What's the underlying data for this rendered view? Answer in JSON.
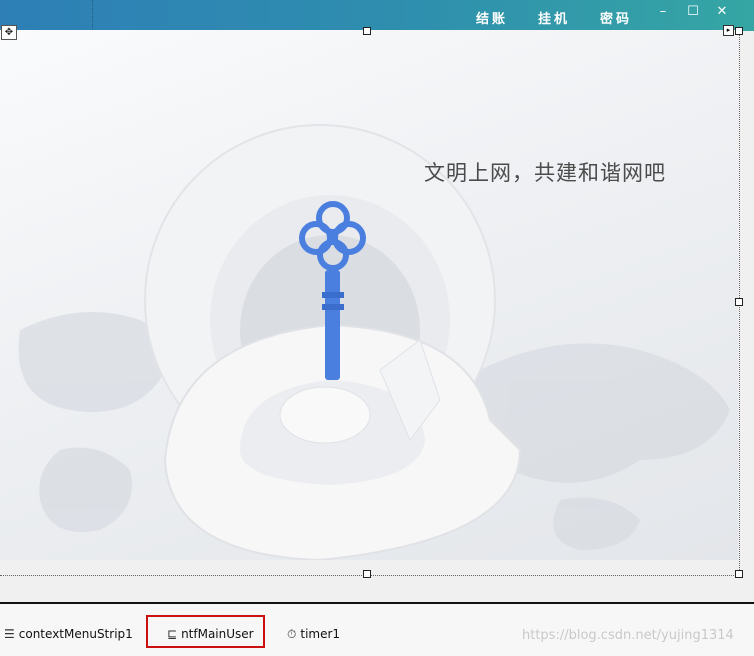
{
  "menu": {
    "checkout": "结账",
    "hangup": "挂机",
    "password": "密码"
  },
  "window_buttons": {
    "minimize": "–",
    "maximize": "☐",
    "close": "✕"
  },
  "banner": {
    "tagline": "文明上网，共建和谐网吧"
  },
  "tray": {
    "items": [
      {
        "label": "contextMenuStrip1",
        "icon": "context-menu-icon"
      },
      {
        "label": "ntfMainUser",
        "icon": "notify-icon",
        "selected": true
      },
      {
        "label": "timer1",
        "icon": "timer-icon"
      }
    ]
  },
  "watermark": "https://blog.csdn.net/yujing1314",
  "colors": {
    "title_start": "#2d7fb6",
    "title_end": "#35a6a4",
    "selection": "#cc1010",
    "key": "#4a7fe0"
  }
}
